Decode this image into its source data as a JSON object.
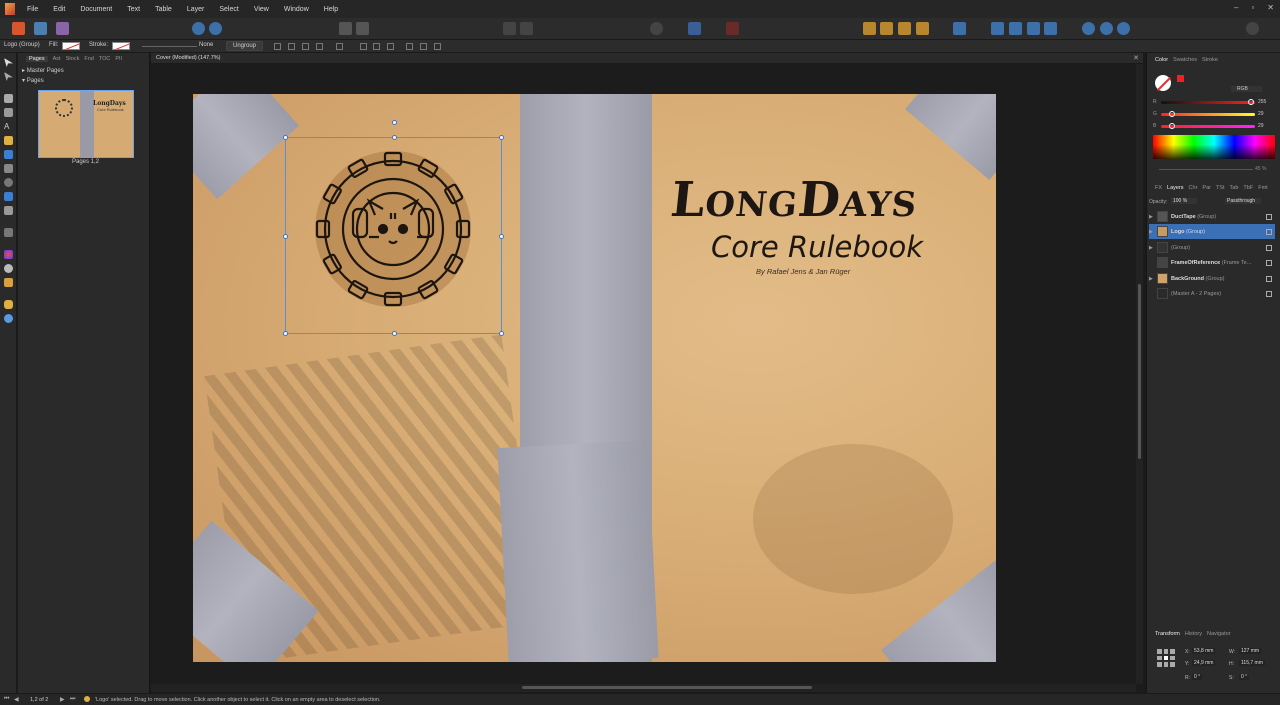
{
  "menubar": {
    "items": [
      "File",
      "Edit",
      "Document",
      "Text",
      "Table",
      "Layer",
      "Select",
      "View",
      "Window",
      "Help"
    ]
  },
  "context": {
    "selection_name": "Logo (Group)",
    "fill_label": "Fill:",
    "stroke_label": "Stroke:",
    "stroke_width": "None",
    "ungroup_label": "Ungroup"
  },
  "pages_panel": {
    "tabs": [
      "Pages",
      "Ast",
      "Stock",
      "Fnd",
      "TOC",
      "PII"
    ],
    "master_pages_label": "Master Pages",
    "pages_label": "Pages",
    "thumbnail_label": "Pages 1,2",
    "thumb_title": "LongDays",
    "thumb_subtitle": "Core Rulebook"
  },
  "document": {
    "tab_title": "Cover (Modified) (147.7%)",
    "title": "LongDays",
    "subtitle": "Core Rulebook",
    "authors": "By Rafael Jens & Jan Rüger"
  },
  "color_panel": {
    "tabs": [
      "Color",
      "Swatches",
      "Stroke"
    ],
    "mode": "RGB",
    "r": "255",
    "g": "29",
    "b": "29",
    "r_label": "R",
    "g_label": "G",
    "b_label": "B",
    "opacity_value": "45 %"
  },
  "layers_panel": {
    "tabs": [
      "FX",
      "Layers",
      "Chr",
      "Par",
      "TSt",
      "Tab",
      "TbF",
      "Fmt"
    ],
    "opacity_label": "Opacity:",
    "opacity_value": "100 %",
    "blend_mode": "Passthrough",
    "layers": [
      {
        "name": "DuctTape",
        "type": "(Group)"
      },
      {
        "name": "Logo",
        "type": "(Group)"
      },
      {
        "name": "",
        "type": "(Group)"
      },
      {
        "name": "FrameOfReference",
        "type": "(Frame Te..."
      },
      {
        "name": "BackGround",
        "type": "(Group)"
      },
      {
        "name": "",
        "type": "(Master A - 2 Pages)"
      }
    ]
  },
  "transform_panel": {
    "tabs": [
      "Transform",
      "History",
      "Navigator"
    ],
    "x_label": "X:",
    "x": "53,8 mm",
    "y_label": "Y:",
    "y": "24,9 mm",
    "w_label": "W:",
    "w": "127 mm",
    "h_label": "H:",
    "h": "115,7 mm",
    "r_label": "R:",
    "r": "0 °",
    "s_label": "S:",
    "s": "0 °"
  },
  "status": {
    "page": "1,2 of 2",
    "message": "'Logo' selected. Drag to move selection. Click another object to select it. Click on an empty area to deselect selection."
  },
  "colors": {
    "accent": "#3b6fb6",
    "paper": "#d9ae76",
    "tape": "#a4a5b1"
  }
}
